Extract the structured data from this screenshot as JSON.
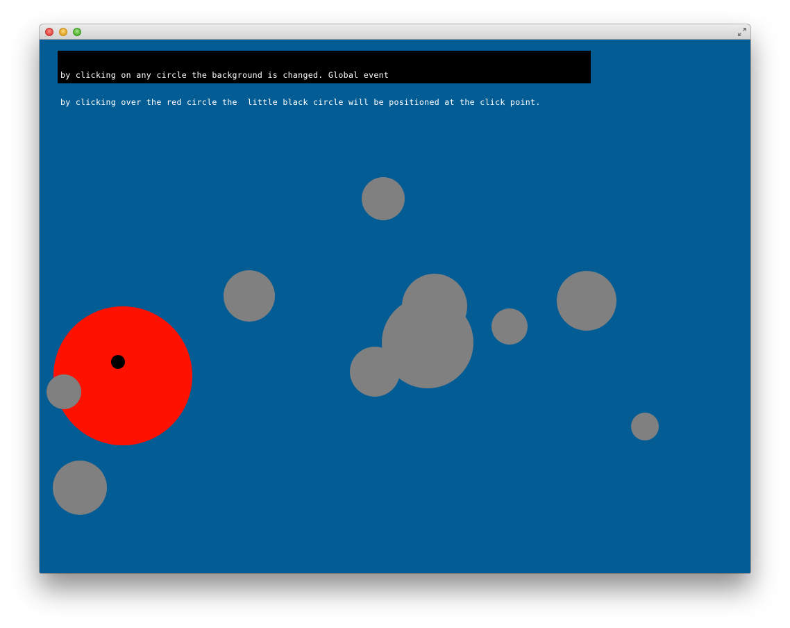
{
  "window": {
    "buttons": {
      "close": "close-icon",
      "minimize": "minimize-icon",
      "zoom": "zoom-icon",
      "fullscreen": "fullscreen-icon"
    }
  },
  "scene": {
    "background_color": "#045c94",
    "info_lines": [
      "by clicking on any circle the background is changed. Global event",
      "by clicking over the red circle the  little black circle will be positioned at the click point."
    ],
    "colors": {
      "red_circle": "#ff1100",
      "marker": "#000000",
      "gray_circle": "#808080"
    }
  }
}
